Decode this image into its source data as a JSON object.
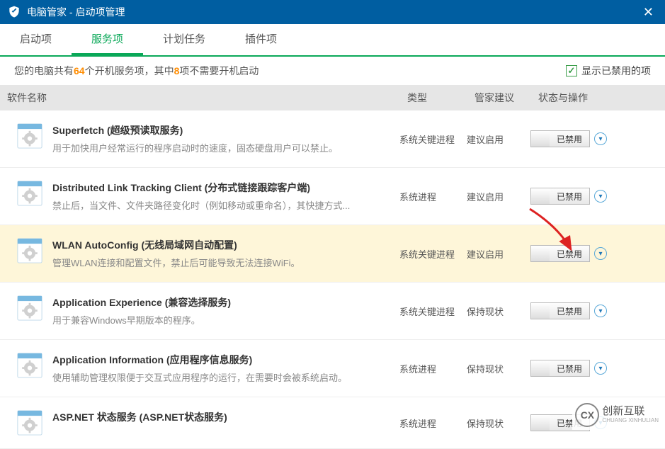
{
  "window": {
    "title": "电脑管家 - 启动项管理"
  },
  "tabs": [
    "启动项",
    "服务项",
    "计划任务",
    "插件项"
  ],
  "active_tab": 1,
  "summary": {
    "p1": "您的电脑共有 ",
    "count_services": "64",
    "p2": " 个开机服务项，其中 ",
    "count_nostart": "8",
    "p3": " 项不需要开机启动"
  },
  "checkbox_label": "显示已禁用的项",
  "columns": {
    "name": "软件名称",
    "type": "类型",
    "suggest": "管家建议",
    "action": "状态与操作"
  },
  "switch_label": "已禁用",
  "items": [
    {
      "title": "Superfetch (超级预读取服务)",
      "desc": "用于加快用户经常运行的程序启动时的速度，固态硬盘用户可以禁止。",
      "type": "系统关键进程",
      "suggest": "建议启用",
      "highlight": false
    },
    {
      "title": "Distributed Link Tracking Client (分布式链接跟踪客户端)",
      "desc": "禁止后，当文件、文件夹路径变化时（例如移动或重命名），其快捷方式...",
      "type": "系统进程",
      "suggest": "建议启用",
      "highlight": false
    },
    {
      "title": "WLAN AutoConfig (无线局域网自动配置)",
      "desc": "管理WLAN连接和配置文件，禁止后可能导致无法连接WiFi。",
      "type": "系统关键进程",
      "suggest": "建议启用",
      "highlight": true
    },
    {
      "title": "Application Experience (兼容选择服务)",
      "desc": "用于兼容Windows早期版本的程序。",
      "type": "系统关键进程",
      "suggest": "保持现状",
      "highlight": false
    },
    {
      "title": "Application Information (应用程序信息服务)",
      "desc": "使用辅助管理权限便于交互式应用程序的运行，在需要时会被系统启动。",
      "type": "系统进程",
      "suggest": "保持现状",
      "highlight": false
    },
    {
      "title": "ASP.NET 状态服务 (ASP.NET状态服务)",
      "desc": "",
      "type": "系统进程",
      "suggest": "保持现状",
      "highlight": false
    }
  ],
  "watermark": {
    "line1": "创新互联",
    "line2": "CHUANG XINHULIAN"
  }
}
